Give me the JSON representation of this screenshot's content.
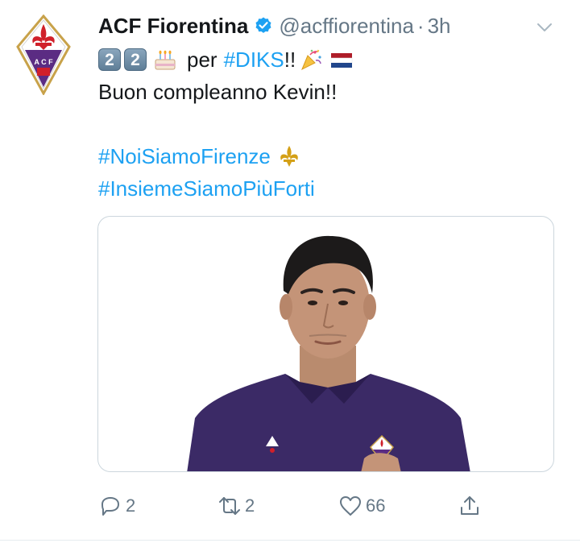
{
  "author": {
    "display_name": "ACF Fiorentina",
    "handle": "@acffiorentina",
    "separator": "·",
    "time": "3h",
    "verified": true,
    "avatar_icon": "fiorentina-crest-icon",
    "avatar_letters": "A C F"
  },
  "tweet": {
    "keycap_digits": [
      "2",
      "2"
    ],
    "per_text": "per",
    "hashtag_diks": "#DIKS",
    "exclaim": "!!",
    "emojis": [
      "birthday-cake-icon",
      "party-popper-icon",
      "netherlands-flag-icon",
      "fleur-de-lis-icon"
    ],
    "line2": "Buon compleanno Kevin!!",
    "hashtag_1": "#NoiSiamoFirenze",
    "hashtag_2": "#InsiemeSiamoPiùForti"
  },
  "actions": {
    "reply_count": "2",
    "retweet_count": "2",
    "like_count": "66"
  },
  "colors": {
    "link": "#1da1f2",
    "muted": "#657786",
    "text": "#14171a",
    "verified": "#1da1f2",
    "kit_purple": "#3b2a66"
  }
}
